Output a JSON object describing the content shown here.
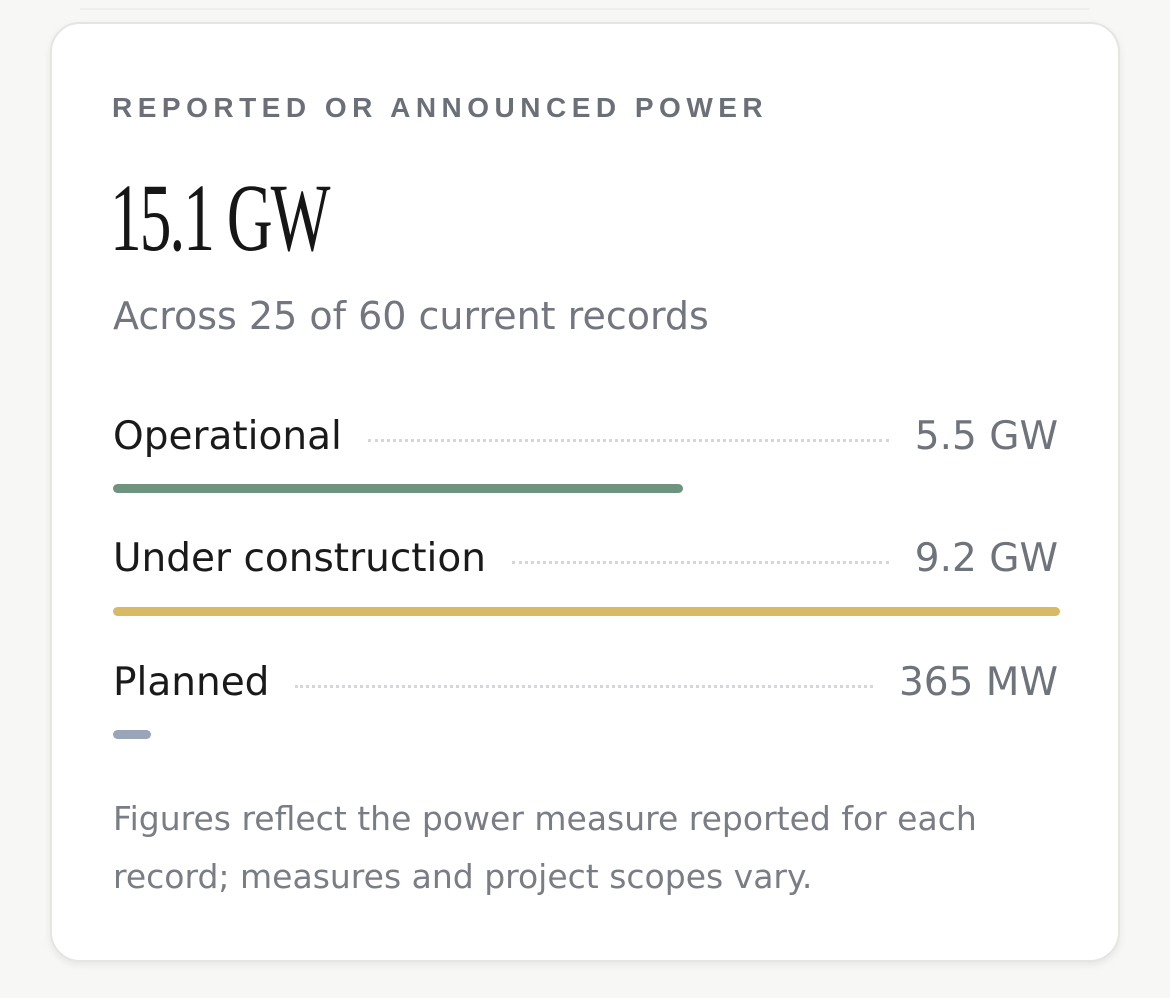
{
  "card": {
    "eyebrow": "REPORTED OR ANNOUNCED POWER",
    "total": "15.1 GW",
    "subtitle": "Across 25 of 60 current records",
    "breakdown": [
      {
        "label": "Operational",
        "value": "5.5 GW",
        "fraction": 0.602,
        "color": "#6e9480"
      },
      {
        "label": "Under construction",
        "value": "9.2 GW",
        "fraction": 1.0,
        "color": "#d8b966"
      },
      {
        "label": "Planned",
        "value": "365 MW",
        "fraction": 0.04,
        "color": "#9aa6b8"
      }
    ],
    "footnote": "Figures reflect the power measure reported for each record; measures and project scopes vary."
  }
}
